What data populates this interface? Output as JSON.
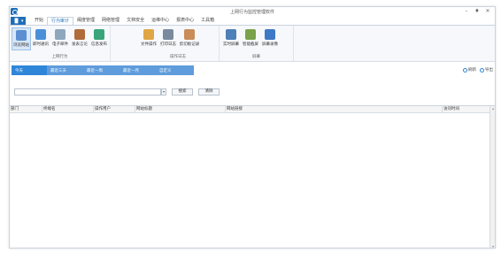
{
  "window": {
    "title": "上网行为监控管理软件",
    "controls": [
      "–",
      "♦",
      "✕"
    ]
  },
  "menu": {
    "home": "▐▌ ▾",
    "tabs": [
      "开始",
      "行为审计",
      "阈度管理",
      "网络管理",
      "文档安全",
      "运维中心",
      "报表中心",
      "工具箱"
    ],
    "active_index": 1
  },
  "ribbon": {
    "groups": [
      {
        "label": "上网行为",
        "items": [
          {
            "label": "浏览网站",
            "icon": "browser-icon",
            "color": "#5b8fd1"
          },
          {
            "label": "即时通讯",
            "icon": "chat-icon",
            "color": "#4a90d9"
          },
          {
            "label": "电子邮件",
            "icon": "mail-icon",
            "color": "#8fa6bf"
          },
          {
            "label": "发表言论",
            "icon": "post-icon",
            "color": "#b06b3a"
          },
          {
            "label": "信息发布",
            "icon": "publish-icon",
            "color": "#3aa57a"
          }
        ]
      },
      {
        "label": "操作日志",
        "items": [
          {
            "label": "文件操作",
            "icon": "folder-icon",
            "color": "#e0a545"
          },
          {
            "label": "打印日志",
            "icon": "printer-icon",
            "color": "#7a8a9e"
          },
          {
            "label": "剪切板记录",
            "icon": "clipboard-icon",
            "color": "#c98d5a"
          }
        ]
      },
      {
        "label": "屏幕",
        "items": [
          {
            "label": "实时屏幕",
            "icon": "monitor-icon",
            "color": "#4d7fb8"
          },
          {
            "label": "智能截屏",
            "icon": "screenshot-icon",
            "color": "#7aa24a"
          },
          {
            "label": "屏幕录像",
            "icon": "record-icon",
            "color": "#3f78c4"
          }
        ]
      }
    ]
  },
  "filters": {
    "tabs": [
      "今天",
      "最近三天",
      "最近一周",
      "最近一月",
      "自定义"
    ],
    "active_index": 0,
    "tools": [
      {
        "label": "刷新",
        "icon": "refresh-icon"
      },
      {
        "label": "导出",
        "icon": "export-icon"
      }
    ]
  },
  "search": {
    "value": "",
    "placeholder": "",
    "search_label": "搜索",
    "clear_label": "清除"
  },
  "table": {
    "columns": [
      "部门",
      "终端名",
      "操作用户",
      "网站标题",
      "网站链接",
      "访问时间"
    ]
  },
  "colors": {
    "accent": "#1e6fb8",
    "filter_tab": "#5e9cdc",
    "filter_tab_active": "#2f86d8"
  }
}
